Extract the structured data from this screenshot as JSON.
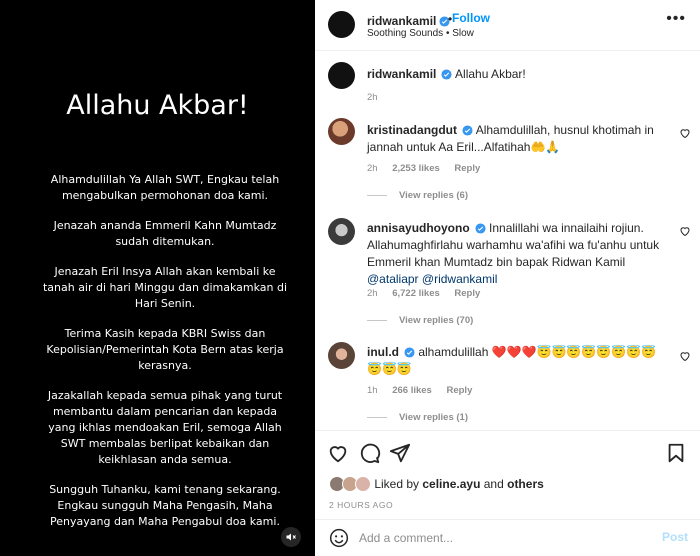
{
  "media": {
    "title": "Allahu Akbar!",
    "paragraphs": [
      "Alhamdulillah Ya Allah SWT, Engkau telah mengabulkan permohonan doa kami.",
      "Jenazah ananda Emmeril Kahn Mumtadz sudah ditemukan.",
      "Jenazah Eril Insya Allah akan kembali ke tanah air di hari Minggu dan dimakamkan di Hari Senin.",
      "Terima Kasih kepada KBRI Swiss dan Kepolisian/Pemerintah Kota Bern atas kerja kerasnya.",
      "Jazakallah kepada semua pihak yang turut membantu dalam pencarian dan kepada yang ikhlas mendoakan Eril, semoga Allah SWT membalas berlipat kebaikan dan keikhlasan anda semua.",
      "Sungguh Tuhanku, kami tenang sekarang. Engkau sungguh Maha Pengasih, Maha Penyayang dan Maha Pengabul doa kami."
    ]
  },
  "header": {
    "username": "ridwankamil",
    "separator": "•",
    "follow_label": "Follow",
    "subtitle": "Soothing Sounds • Slow",
    "more": "•••"
  },
  "caption": {
    "username": "ridwankamil",
    "text": "Allahu Akbar!",
    "time": "2h"
  },
  "comments": [
    {
      "username": "kristinadangdut",
      "text": "Alhamdulillah, husnul khotimah in jannah untuk Aa Eril...Alfatihah🤲🙏",
      "time": "2h",
      "likes": "2,253 likes",
      "reply": "Reply",
      "view_replies": "View replies (6)"
    },
    {
      "username": "annisayudhoyono",
      "text": "Innalillahi wa innailaihi rojiun. Allahumaghfirlahu warhamhu wa'afihi wa fu'anhu untuk Emmeril khan Mumtadz bin bapak Ridwan Kamil ",
      "mention1": "@ataliapr",
      "mention2": "@ridwankamil",
      "time": "2h",
      "likes": "6,722 likes",
      "reply": "Reply",
      "view_replies": "View replies (70)"
    },
    {
      "username": "inul.d",
      "text": "alhamdulillah ❤️❤️❤️😇😇😇😇😇😇😇😇😇😇😇",
      "time": "1h",
      "likes": "266 likes",
      "reply": "Reply",
      "view_replies": "View replies (1)"
    }
  ],
  "footer": {
    "liked_prefix": "Liked by ",
    "liked_user": "celine.ayu",
    "liked_mid": " and ",
    "liked_others": "others",
    "date": "2 HOURS AGO",
    "comment_placeholder": "Add a comment...",
    "post_label": "Post"
  },
  "colors": {
    "accent": "#0095f6",
    "verified": "#3897f0",
    "muted": "#8e8e8e",
    "post_disabled": "#b2dffc"
  },
  "icons": [
    "verified-badge-icon",
    "more-options-icon",
    "heart-icon",
    "comment-icon",
    "share-icon",
    "bookmark-icon",
    "emoji-icon",
    "mute-icon"
  ]
}
